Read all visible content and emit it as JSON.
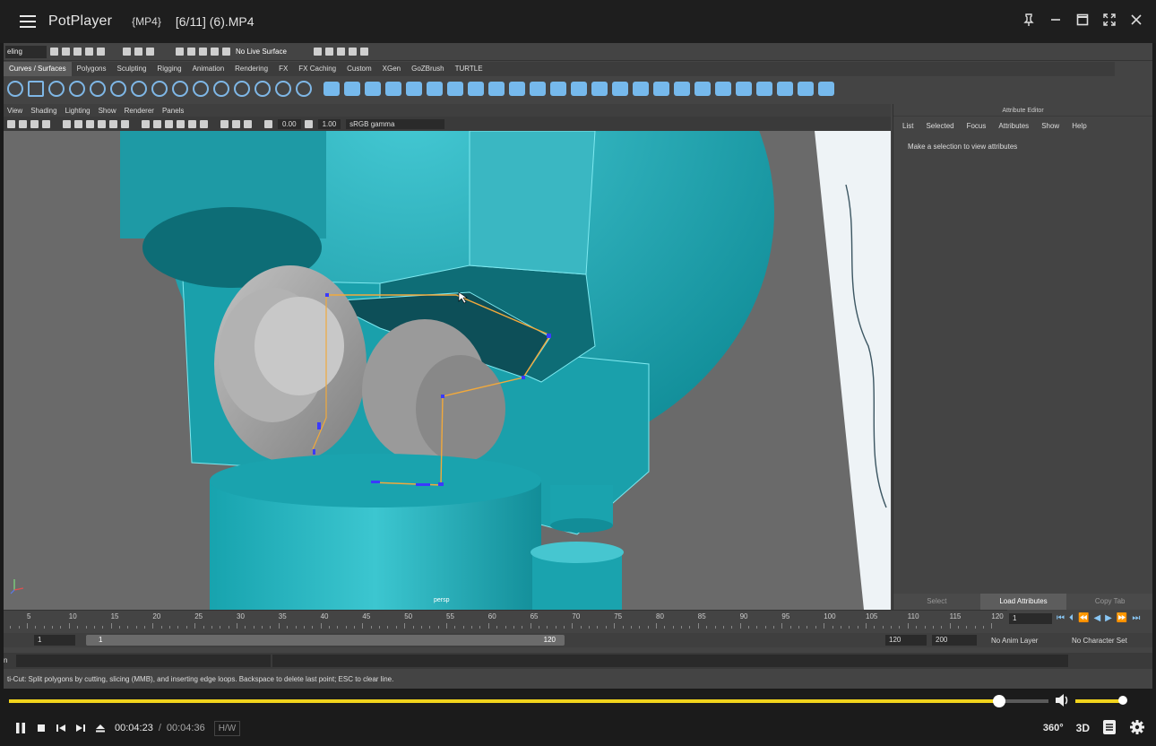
{
  "player": {
    "app_name": "PotPlayer",
    "format": "{MP4}",
    "file_name": "[6/11] (6).MP4",
    "time_current": "00:04:23",
    "time_separator": "/",
    "time_total": "00:04:36",
    "hw_label": "H/W",
    "badge_360": "360°",
    "badge_3d": "3D",
    "progress_fraction": 0.953,
    "volume_fraction": 0.95,
    "accent_color": "#f1d31c"
  },
  "maya": {
    "mode": "eling",
    "live_surface": "No Live Surface",
    "shelf_tabs": [
      "Curves / Surfaces",
      "Polygons",
      "Sculpting",
      "Rigging",
      "Animation",
      "Rendering",
      "FX",
      "FX Caching",
      "Custom",
      "XGen",
      "GoZBrush",
      "TURTLE"
    ],
    "panel_menu": [
      "View",
      "Shading",
      "Lighting",
      "Show",
      "Renderer",
      "Panels"
    ],
    "exposure": "0.00",
    "gamma_value": "1.00",
    "color_space": "sRGB gamma",
    "camera": "persp",
    "attribute_editor": {
      "title": "Attribute Editor",
      "menu": [
        "List",
        "Selected",
        "Focus",
        "Attributes",
        "Show",
        "Help"
      ],
      "message": "Make a selection to view attributes",
      "buttons": [
        "Select",
        "Load Attributes",
        "Copy Tab"
      ]
    },
    "time_ticks": [
      "5",
      "10",
      "15",
      "20",
      "25",
      "30",
      "35",
      "40",
      "45",
      "50",
      "55",
      "60",
      "65",
      "70",
      "75",
      "80",
      "85",
      "90",
      "95",
      "100",
      "105",
      "110",
      "115",
      "120"
    ],
    "current_frame": "1",
    "range_start": "1",
    "range_inner_start": "1",
    "range_inner_end": "120",
    "range_end": "120",
    "anim_end": "200",
    "anim_layer": "No Anim Layer",
    "character_set": "No Character Set",
    "cmd_label": "n",
    "help_line": "ti-Cut: Split polygons by cutting, slicing (MMB), and inserting edge loops. Backspace to delete last point; ESC to clear line."
  }
}
